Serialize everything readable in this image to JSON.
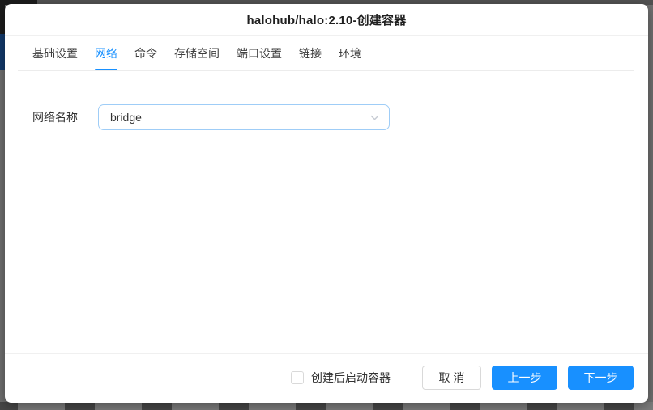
{
  "dialog": {
    "title": "halohub/halo:2.10-创建容器"
  },
  "tabs": [
    {
      "label": "基础设置",
      "active": false
    },
    {
      "label": "网络",
      "active": true
    },
    {
      "label": "命令",
      "active": false
    },
    {
      "label": "存储空间",
      "active": false
    },
    {
      "label": "端口设置",
      "active": false
    },
    {
      "label": "链接",
      "active": false
    },
    {
      "label": "环境",
      "active": false
    }
  ],
  "form": {
    "network_name_label": "网络名称",
    "network_select_value": "bridge"
  },
  "footer": {
    "start_after_create_label": "创建后启动容器",
    "checkbox_checked": false,
    "cancel_label": "取 消",
    "prev_label": "上一步",
    "next_label": "下一步"
  },
  "colors": {
    "primary": "#1890ff",
    "select_border": "#9fcdf7"
  }
}
